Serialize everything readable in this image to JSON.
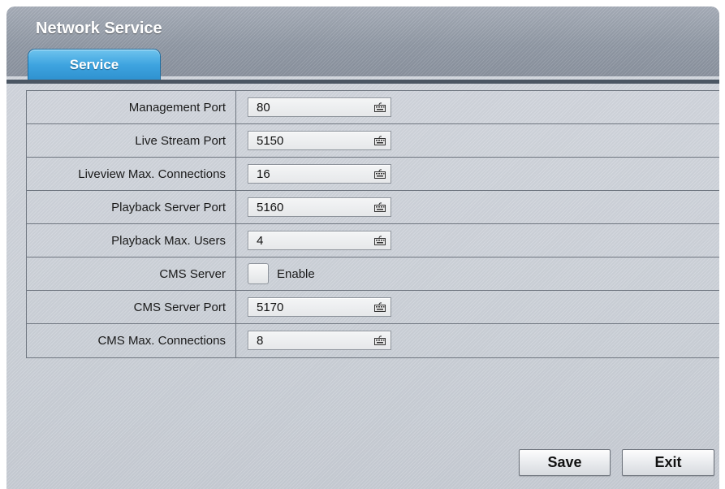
{
  "window": {
    "title": "Network Service"
  },
  "tabs": [
    {
      "label": "Service",
      "active": true
    }
  ],
  "rows": [
    {
      "label": "Management Port",
      "value": "80"
    },
    {
      "label": "Live Stream Port",
      "value": "5150"
    },
    {
      "label": "Liveview Max. Connections",
      "value": "16"
    },
    {
      "label": "Playback Server Port",
      "value": "5160"
    },
    {
      "label": "Playback Max. Users",
      "value": "4"
    },
    {
      "label": "CMS Server",
      "checkbox_label": "Enable",
      "checked": false
    },
    {
      "label": "CMS Server Port",
      "value": "5170"
    },
    {
      "label": "CMS Max. Connections",
      "value": "8"
    }
  ],
  "buttons": {
    "save": "Save",
    "exit": "Exit"
  },
  "colors": {
    "accent_tab": "#3ea4e0",
    "titlebar": "#939ba7"
  },
  "icons": {
    "input_trailing": "keyboard-icon"
  }
}
